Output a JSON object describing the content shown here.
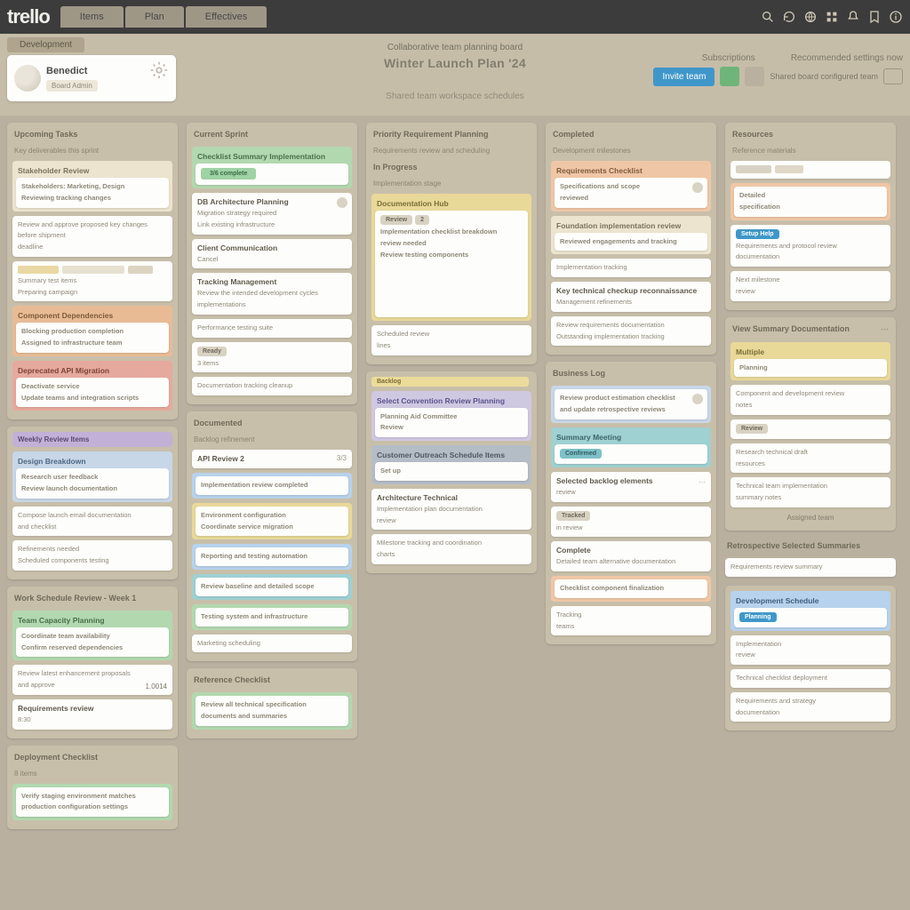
{
  "brand": "trello",
  "nav": {
    "tabs": [
      "Items",
      "Plan",
      "Effectives"
    ]
  },
  "board_tab": "Development",
  "profile": {
    "name": "Benedict",
    "sub": "Board Admin"
  },
  "strip": {
    "subtitle": "Collaborative team planning board",
    "title": "Winter Launch Plan '24",
    "desc": "Shared team workspace schedules",
    "r1": "Subscriptions",
    "r2": "Recommended settings now",
    "btn": "Invite team",
    "r3": "Shared board configured team"
  },
  "columns": [
    {
      "lists": [
        {
          "title": "Upcoming Tasks",
          "sub": "Key deliverables this sprint",
          "cards": [
            {
              "band": "band-cream",
              "head": "Stakeholder Review",
              "lines": [
                "Stakeholders: Marketing, Design",
                "Reviewing tracking changes"
              ]
            },
            {
              "lines": [
                "Review and approve proposed key changes",
                "before shipment",
                "deadline"
              ]
            },
            {
              "chips": [
                {
                  "w": 46,
                  "c": "#e9d8a3"
                },
                {
                  "w": 70,
                  "c": "#e6e0d1"
                },
                {
                  "w": 28,
                  "c": "#dcd4c0"
                }
              ],
              "lines": [
                "Summary test items",
                "Preparing campaign"
              ]
            },
            {
              "band": "band-orange",
              "head": "Component Dependencies",
              "lines": [
                "Blocking production completion",
                "Assigned to infrastructure team"
              ]
            },
            {
              "band": "band-red",
              "head": "Deprecated API Migration",
              "lines": [
                "Deactivate service",
                "Update teams and integration scripts"
              ]
            }
          ]
        },
        {
          "title_band": "band-purple",
          "title": "Weekly Review Items",
          "cards": [
            {
              "band": "band-bluepale",
              "head": "Design Breakdown",
              "lines": [
                "Research user feedback",
                "Review launch documentation"
              ]
            },
            {
              "lines": [
                "Compose launch email documentation",
                "and checklist"
              ]
            },
            {
              "lines": [
                "Refinements needed",
                "Scheduled components testing"
              ]
            }
          ]
        },
        {
          "title": "Work Schedule Review - Week 1",
          "cards": [
            {
              "band": "band-green",
              "head": "Team Capacity Planning",
              "lines": [
                "Coordinate team availability",
                "Confirm reserved dependencies"
              ]
            },
            {
              "lines": [
                "Review latest enhancement proposals",
                "and approve"
              ],
              "right_num": "1.0014"
            },
            {
              "head": "Requirements review",
              "lines": [
                "8:30"
              ]
            }
          ]
        },
        {
          "title": "Deployment Checklist",
          "sub": "8 items",
          "cards": [
            {
              "band": "band-green",
              "lines": [
                "Verify staging environment matches",
                "production configuration settings"
              ]
            }
          ]
        }
      ]
    },
    {
      "lists": [
        {
          "title": "Current Sprint",
          "cards": [
            {
              "band": "band-green",
              "head": "Checklist Summary Implementation",
              "pills": [
                {
                  "t": "3/6 complete",
                  "c": "pill-green pill-wide"
                }
              ]
            },
            {
              "head": "DB Architecture Planning",
              "lines": [
                "Migration strategy required",
                "Link existing infrastructure"
              ],
              "chip": true
            },
            {
              "head": "Client Communication",
              "lines": [
                "Cancel"
              ]
            },
            {
              "head": "Tracking Management",
              "lines": [
                "Review the intended development cycles",
                "implementations"
              ]
            },
            {
              "lines": [
                "Performance testing suite"
              ]
            },
            {
              "pills": [
                {
                  "t": "Ready",
                  "c": "pill-grey"
                }
              ],
              "lines": [
                "3 items"
              ]
            },
            {
              "lines": [
                "Documentation tracking cleanup"
              ]
            }
          ]
        },
        {
          "title": "Documented",
          "sub": "Backlog refinement",
          "cards": [
            {
              "head": "API Review 2",
              "right": "3/3"
            },
            {
              "band": "band-blue",
              "lines": [
                "Implementation review completed"
              ]
            },
            {
              "band": "band-yellow",
              "lines": [
                "Environment configuration",
                "Coordinate service migration"
              ]
            },
            {
              "band": "band-blue",
              "lines": [
                "Reporting and testing automation"
              ]
            },
            {
              "band": "band-teal",
              "lines": [
                "Review baseline and detailed scope"
              ]
            },
            {
              "band": "band-green",
              "lines": [
                "Testing system and infrastructure"
              ]
            },
            {
              "lines": [
                "Marketing scheduling"
              ]
            }
          ]
        },
        {
          "title": "Reference Checklist",
          "cards": [
            {
              "band": "band-green",
              "lines": [
                "Review all technical specification",
                "documents and summaries"
              ]
            }
          ]
        }
      ]
    },
    {
      "lists": [
        {
          "title": "Priority Requirement Planning",
          "sub": "Requirements review and scheduling",
          "head2": "In Progress",
          "h2sub": "Implementation stage",
          "cards": [
            {
              "band": "band-yellow",
              "head": "Documentation Hub",
              "lines": [
                "Implementation checklist breakdown",
                "review needed"
              ],
              "lines2": [
                "Review testing components"
              ],
              "pills": [
                {
                  "t": "Review",
                  "c": "pill-grey"
                },
                {
                  "t": "2",
                  "c": "pill-grey"
                }
              ],
              "bigblock": true
            },
            {
              "lines": [
                "Scheduled review",
                "lines"
              ]
            }
          ]
        },
        {
          "title_pill": {
            "t": "Backlog",
            "c": "pill-yellow"
          },
          "cards": [
            {
              "band": "band-lav",
              "head": "Select Convention Review Planning",
              "lines": [
                "Planning Aid Committee",
                "Review"
              ]
            },
            {
              "band": "band-slate",
              "head": "Customer Outreach Schedule Items",
              "lines": [
                "Set up"
              ]
            },
            {
              "head": "Architecture Technical",
              "lines": [
                "Implementation plan documentation",
                "review"
              ]
            },
            {
              "lines": [
                "Milestone tracking and coordination",
                "charts"
              ]
            }
          ]
        }
      ]
    },
    {
      "lists": [
        {
          "title": "Completed",
          "sub": "Development milestones",
          "cards": [
            {
              "band": "band-peach",
              "head": "Requirements Checklist",
              "lines": [
                "Specifications and scope",
                "reviewed"
              ],
              "chip_r": true
            },
            {
              "band": "band-cream",
              "head": "Foundation implementation review",
              "lines": [
                "Reviewed engagements and tracking"
              ]
            },
            {
              "lines": [
                "Implementation tracking"
              ]
            },
            {
              "head": "Key technical checkup reconnaissance",
              "sub": "Management refinements"
            },
            {
              "lines": [
                "Review requirements documentation",
                "Outstanding implementation tracking"
              ]
            }
          ]
        },
        {
          "title": "Business Log",
          "cards": [
            {
              "band": "band-bluepale",
              "lines": [
                "Review product estimation checklist",
                "and update retrospective reviews"
              ],
              "chip_r": true
            },
            {
              "band": "band-teal",
              "head": "Summary Meeting",
              "pills": [
                {
                  "t": "Confirmed",
                  "c": "pill-teal"
                }
              ]
            },
            {
              "head": "Selected backlog elements",
              "lines": [
                "review"
              ],
              "right": "…"
            },
            {
              "pills": [
                {
                  "t": "Tracked",
                  "c": "pill-grey"
                }
              ],
              "lines": [
                "in review"
              ]
            },
            {
              "head": "Complete",
              "lines": [
                "Detailed team alternative documentation"
              ]
            },
            {
              "band": "band-peach",
              "lines": [
                "Checklist component finalization"
              ]
            },
            {
              "lines": [
                "Tracking",
                "teams"
              ]
            }
          ]
        }
      ]
    },
    {
      "lists": [
        {
          "title": "Resources",
          "sub": "Reference materials",
          "cards": [
            {
              "chips": [
                {
                  "w": 40,
                  "c": "#d8d2c2"
                },
                {
                  "w": 32,
                  "c": "#dfd8c7"
                }
              ]
            },
            {
              "band": "band-peach",
              "lines": [
                "Detailed",
                "specification"
              ]
            },
            {
              "pills": [
                {
                  "t": "Setup Help",
                  "c": "pill-blue"
                }
              ],
              "lines": [
                "Requirements and protocol review",
                "documentation"
              ]
            },
            {
              "lines": [
                "Next milestone",
                "review"
              ]
            }
          ]
        },
        {
          "title": "View Summary Documentation",
          "title_chip": true,
          "cards": [
            {
              "band": "band-yellow",
              "head": "Multiple",
              "lines": [
                "Planning"
              ]
            },
            {
              "lines": [
                "Component and development review",
                "notes"
              ]
            },
            {
              "pills": [
                {
                  "t": "Review",
                  "c": "pill-grey"
                }
              ]
            },
            {
              "lines": [
                "Research technical draft",
                "resources"
              ]
            },
            {
              "lines": [
                "Technical team implementation",
                "summary notes"
              ]
            }
          ],
          "footer": "Assigned team"
        },
        {
          "title": "Retrospective Selected Summaries",
          "standalone": true,
          "cards": [
            {
              "lines": [
                "Requirements review summary"
              ]
            }
          ]
        },
        {
          "cards": [
            {
              "band": "band-blue",
              "pills": [
                {
                  "t": "Planning",
                  "c": "pill-blue"
                }
              ],
              "head": "Development Schedule"
            },
            {
              "lines": [
                "Implementation",
                "review"
              ]
            },
            {
              "lines": [
                "Technical checklist deployment"
              ]
            },
            {
              "lines": [
                "Requirements and strategy",
                "documentation"
              ]
            }
          ]
        }
      ]
    }
  ]
}
